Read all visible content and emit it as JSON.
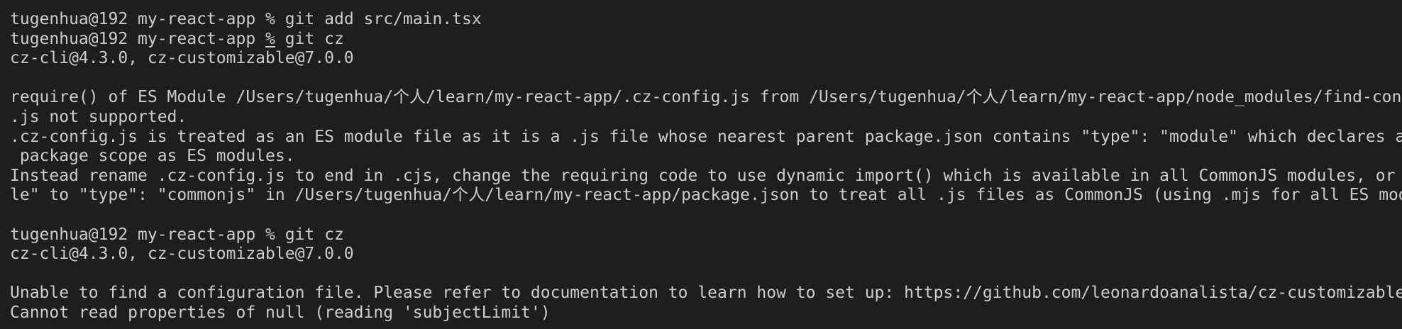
{
  "terminal": {
    "lines": [
      {
        "prompt": "tugenhua@192 my-react-app % ",
        "cmd": "git add src/main.tsx"
      },
      {
        "prompt_a": "tugenhua@192 my-react-app ",
        "prompt_sym": "%",
        "prompt_b": " ",
        "cmd": "git cz"
      },
      {
        "text": "cz-cli@4.3.0, cz-customizable@7.0.0"
      },
      {
        "text": ""
      },
      {
        "text": "require() of ES Module /Users/tugenhua/个人/learn/my-react-app/.cz-config.js from /Users/tugenhua/个人/learn/my-react-app/node_modules/find-config/src/find-config"
      },
      {
        "text": ".js not supported."
      },
      {
        "text": ".cz-config.js is treated as an ES module file as it is a .js file whose nearest parent package.json contains \"type\": \"module\" which declares all .js files in that"
      },
      {
        "text": " package scope as ES modules."
      },
      {
        "text": "Instead rename .cz-config.js to end in .cjs, change the requiring code to use dynamic import() which is available in all CommonJS modules, or change \"type\": \"modu"
      },
      {
        "text": "le\" to \"type\": \"commonjs\" in /Users/tugenhua/个人/learn/my-react-app/package.json to treat all .js files as CommonJS (using .mjs for all ES modules instead)."
      },
      {
        "text": ""
      },
      {
        "prompt": "tugenhua@192 my-react-app % ",
        "cmd": "git cz"
      },
      {
        "text": "cz-cli@4.3.0, cz-customizable@7.0.0"
      },
      {
        "text": ""
      },
      {
        "text": "Unable to find a configuration file. Please refer to documentation to learn how to set up: https://github.com/leonardoanalista/cz-customizable#steps"
      },
      {
        "text": "Cannot read properties of null (reading 'subjectLimit')"
      }
    ]
  }
}
